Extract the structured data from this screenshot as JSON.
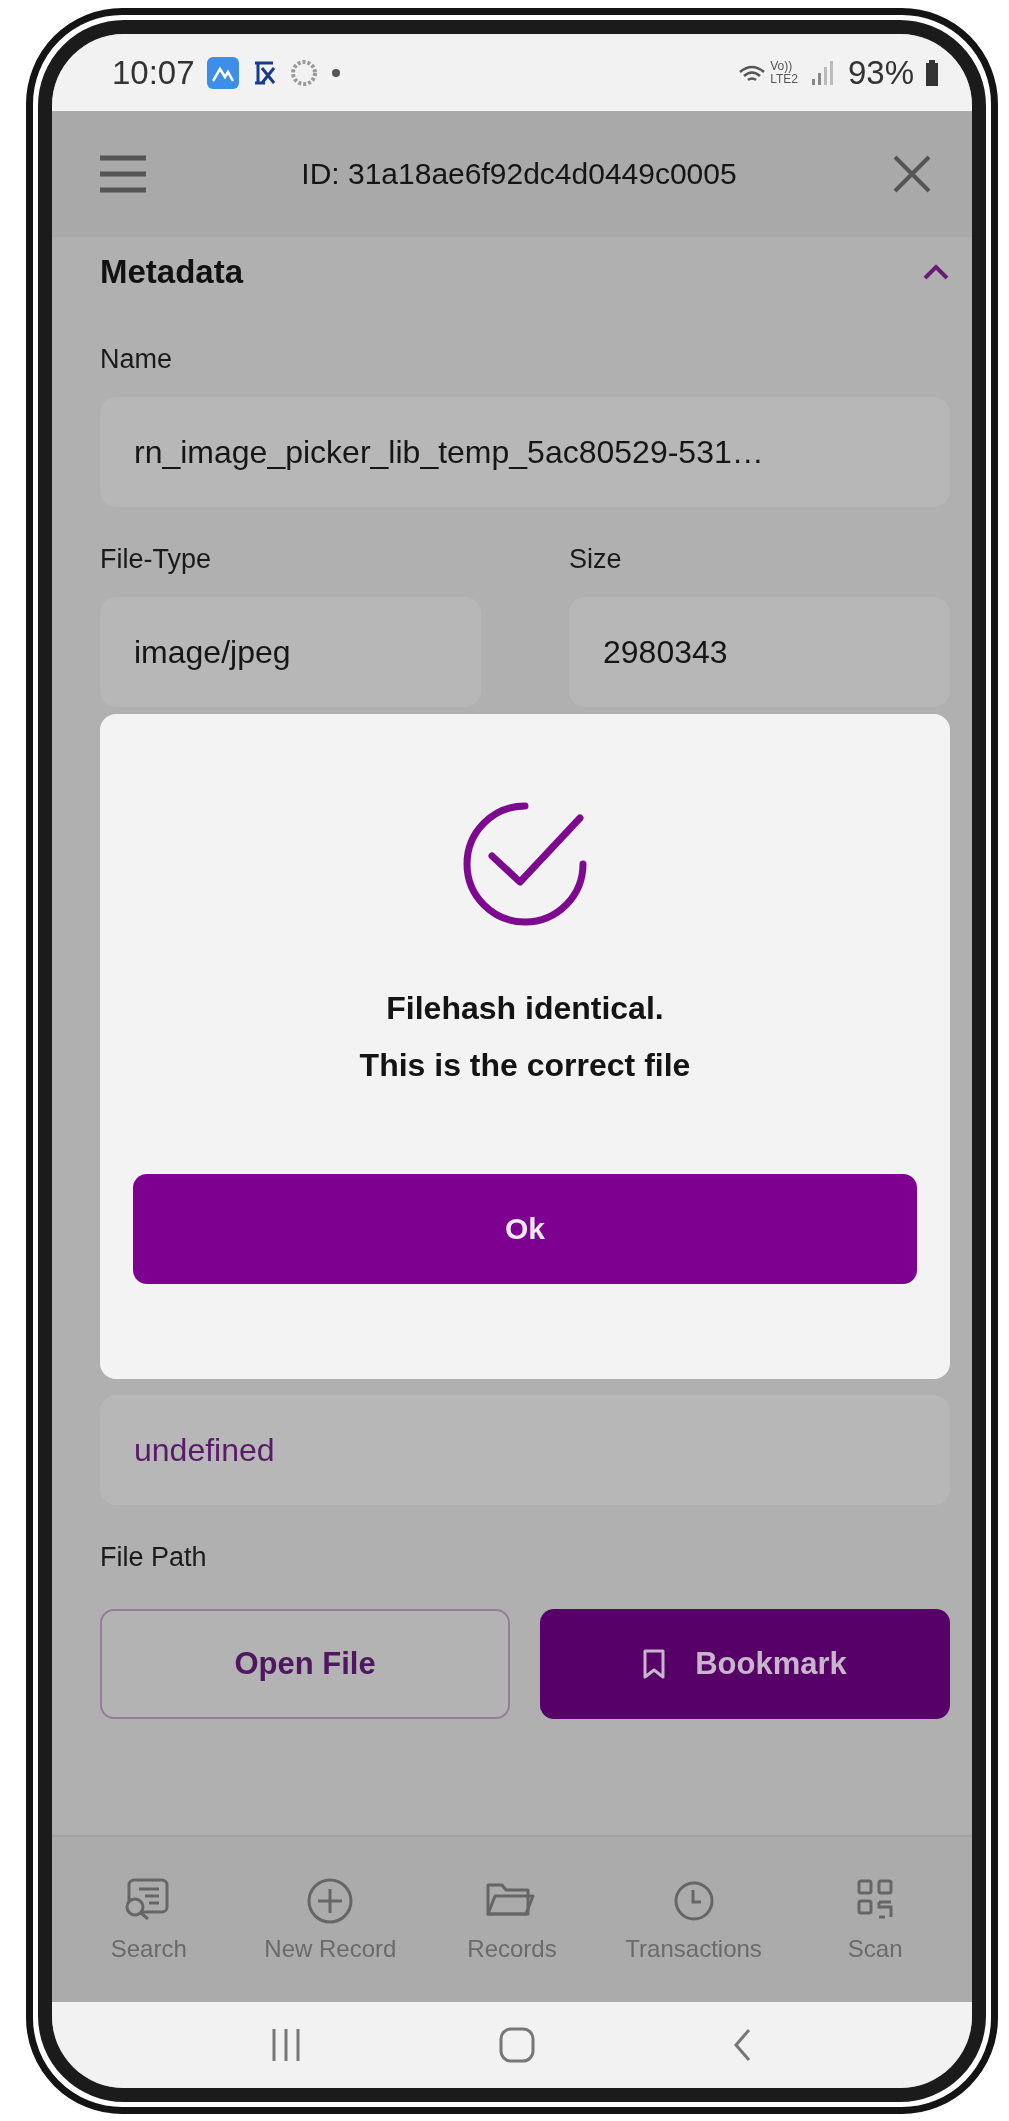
{
  "status_bar": {
    "time": "10:07",
    "battery": "93%",
    "network_labels": [
      "Vo))",
      "LTE2"
    ]
  },
  "header": {
    "title": "ID: 31a18ae6f92dc4d0449c0005"
  },
  "section": {
    "title": "Metadata",
    "expanded": true
  },
  "fields_top": [
    {
      "kind": "wide",
      "label": "Name",
      "value": "rn_image_picker_lib_temp_5ac80529-531…"
    },
    {
      "kind": "half",
      "label": "File-Type",
      "value": "image/jpeg"
    },
    {
      "kind": "half",
      "label": "Size",
      "value": "2980343"
    }
  ],
  "fields_bottom": [
    {
      "kind": "link",
      "value": "undefined"
    },
    {
      "kind": "label",
      "label": "File Path"
    }
  ],
  "actions": [
    {
      "kind": "outline",
      "label": "Open File"
    },
    {
      "kind": "filled",
      "label": "Bookmark"
    }
  ],
  "bottom_nav": [
    {
      "label": "Search"
    },
    {
      "label": "New Record"
    },
    {
      "label": "Records"
    },
    {
      "label": "Transactions"
    },
    {
      "label": "Scan"
    }
  ],
  "modal": {
    "message": "Filehash identical.\nThis is the correct file",
    "button": "Ok"
  }
}
